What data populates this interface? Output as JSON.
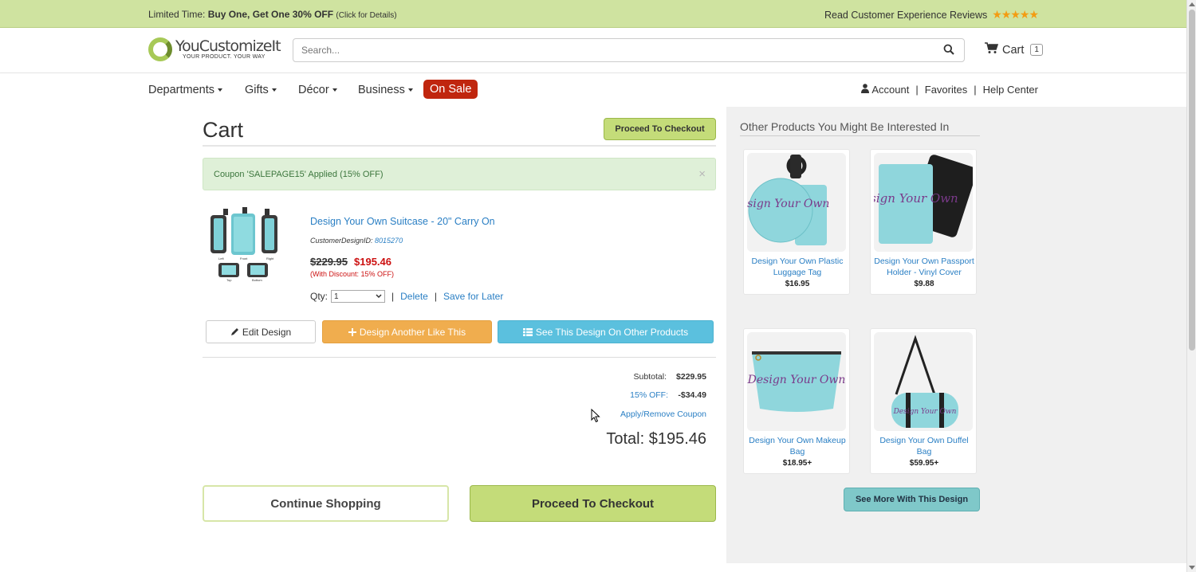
{
  "topbar": {
    "promo_prefix": "Limited Time: ",
    "promo_bold": "Buy One, Get One 30% OFF",
    "promo_small": "(Click for Details)",
    "reviews": "Read Customer Experience Reviews",
    "stars": "★★★★★"
  },
  "header": {
    "logo_name": "YouCustomizeIt",
    "logo_tag": "YOUR PRODUCT. YOUR WAY",
    "search_placeholder": "Search...",
    "cart_label": "Cart",
    "cart_count": "1"
  },
  "nav": {
    "departments": "Departments",
    "gifts": "Gifts",
    "decor": "Décor",
    "business": "Business",
    "on_sale": "On Sale",
    "account": "Account",
    "favorites": "Favorites",
    "help": "Help Center",
    "sep": "|"
  },
  "cart": {
    "title": "Cart",
    "checkout_top": "Proceed To Checkout",
    "coupon_alert": "Coupon 'SALEPAGE15' Applied (15% OFF)",
    "close": "×",
    "item": {
      "name": "Design Your Own Suitcase - 20\" Carry On",
      "design_id_label": "CustomerDesignID: ",
      "design_id": "8015270",
      "price_old": "$229.95",
      "price_new": "$195.46",
      "discount_note": "(With Discount: 15% OFF)",
      "qty_label": "Qty:",
      "qty_value": "1",
      "delete": "Delete",
      "save_later": "Save for Later",
      "image_labels": [
        "Left",
        "Front",
        "Right",
        "Top",
        "Bottom"
      ]
    },
    "edit_design": "Edit Design",
    "design_another": "Design Another Like This",
    "see_other": "See This Design On Other Products",
    "subtotal_label": "Subtotal:",
    "subtotal_value": "$229.95",
    "discount_label": "15% OFF:",
    "discount_value": "-$34.49",
    "coupon_link": "Apply/Remove Coupon",
    "total": "Total: $195.46",
    "continue": "Continue Shopping",
    "checkout_bottom": "Proceed To Checkout"
  },
  "recommendations": {
    "title": "Other Products You Might Be Interested In",
    "thumb_text": "Design Your Own",
    "items": [
      {
        "name": "Design Your Own Plastic Luggage Tag",
        "price": "$16.95"
      },
      {
        "name": "Design Your Own Passport Holder - Vinyl Cover",
        "price": "$9.88"
      },
      {
        "name": "Design Your Own Makeup Bag",
        "price": "$18.95+"
      },
      {
        "name": "Design Your Own Duffel Bag",
        "price": "$59.95+"
      }
    ],
    "see_more": "See More With This Design"
  },
  "colors": {
    "accent_green": "#c4dc79",
    "banner_green": "#cfe3a0",
    "link_blue": "#2a7fc4",
    "sale_red": "#c0260e",
    "price_red": "#cc1111",
    "orange": "#f0ad4e",
    "info_blue": "#5bc0de",
    "teal": "#7fc8c9"
  }
}
